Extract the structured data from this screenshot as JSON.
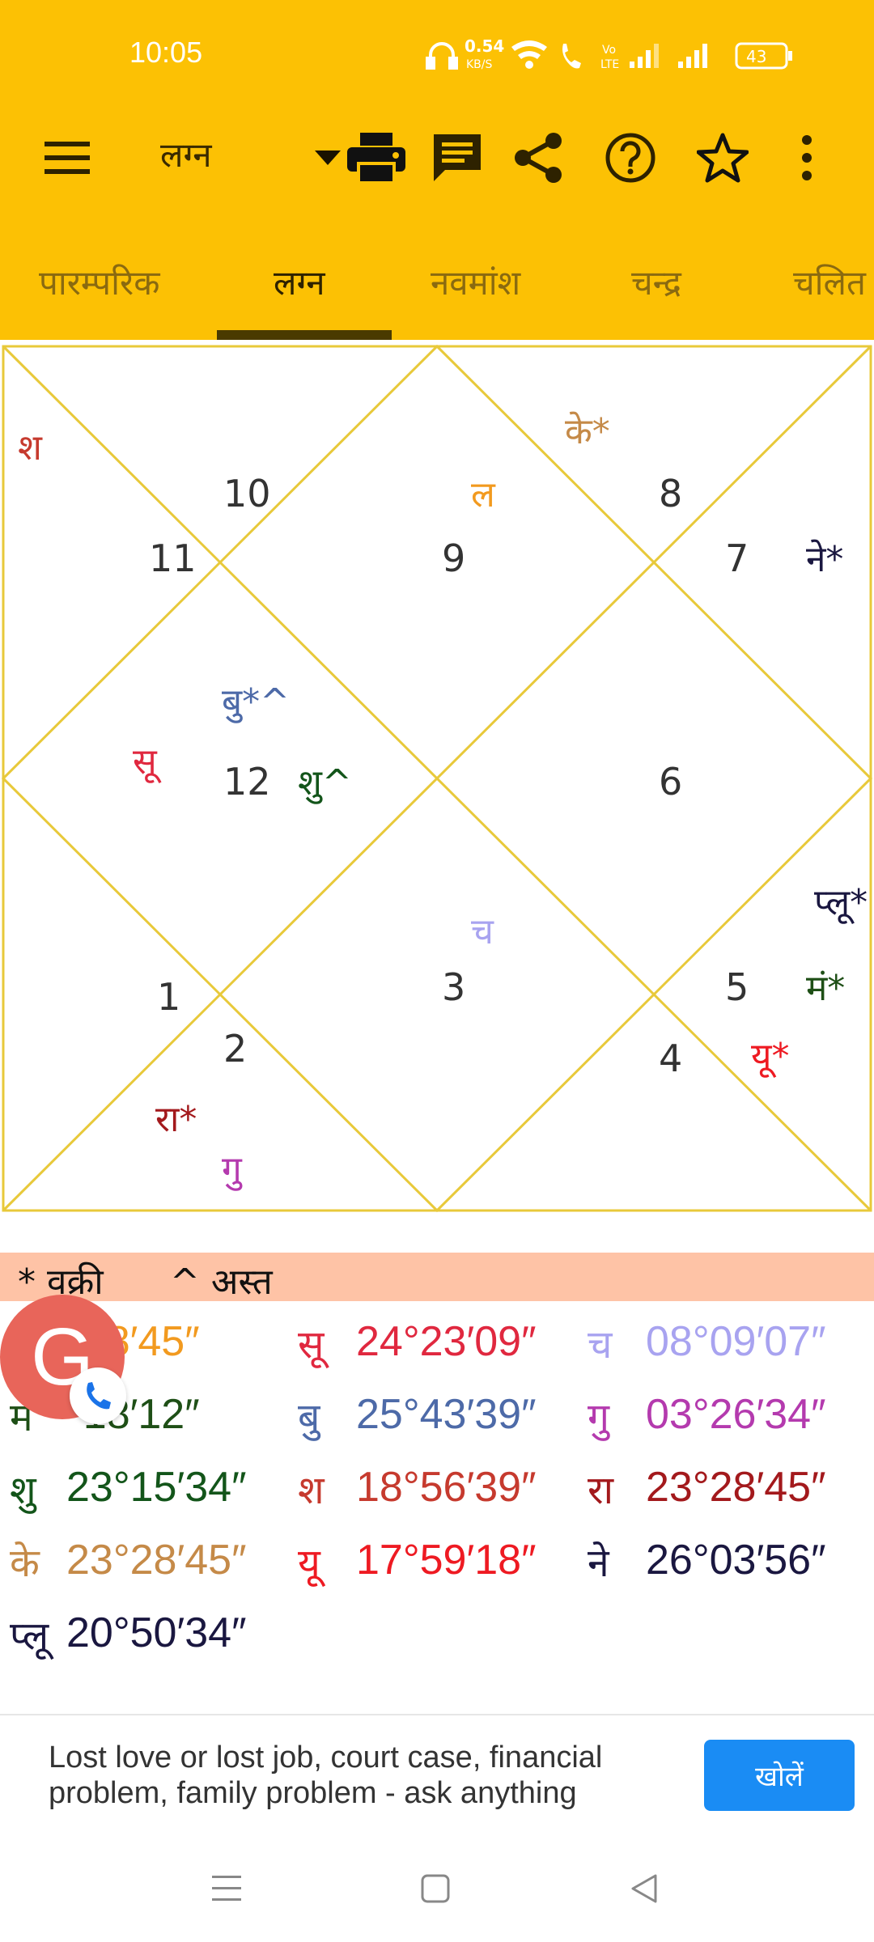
{
  "status": {
    "time": "10:05",
    "speed_value": "0.54",
    "speed_unit": "KB/S",
    "battery": "43"
  },
  "toolbar": {
    "title": "लग्न"
  },
  "tabs": [
    "पारम्परिक",
    "लग्न",
    "नवमांश",
    "चन्द्र",
    "चलित"
  ],
  "chart": {
    "houses": [
      "10",
      "11",
      "9",
      "8",
      "7",
      "12",
      "6",
      "3",
      "1",
      "2",
      "5",
      "4"
    ],
    "planets": {
      "sha": "श",
      "la": "ल",
      "ke": "के*",
      "ne": "ने*",
      "bu": "बु*^",
      "su": "सू",
      "shu": "शु^",
      "ch": "च",
      "plu": "प्लू*",
      "man": "मं*",
      "ra": "रा*",
      "gu": "गु",
      "yu": "यू*"
    },
    "colors": {
      "line": "#E8C93A"
    }
  },
  "legend": {
    "retro": "* वक्री",
    "combust": "^ अस्त"
  },
  "positions": [
    [
      {
        "p": "",
        "d": "°48′45″",
        "c": "#F29A1F"
      },
      {
        "p": "सू",
        "d": "24°23′09″",
        "c": "#E0283F"
      },
      {
        "p": "च",
        "d": "08°09′07″",
        "c": "#A8A3F0"
      }
    ],
    [
      {
        "p": "म",
        "d": "°18′12″",
        "c": "#1E4F16"
      },
      {
        "p": "बु",
        "d": "25°43′39″",
        "c": "#4D6AA8"
      },
      {
        "p": "गु",
        "d": "03°26′34″",
        "c": "#B43AAE"
      }
    ],
    [
      {
        "p": "शु",
        "d": "23°15′34″",
        "c": "#13551A"
      },
      {
        "p": "श",
        "d": "18°56′39″",
        "c": "#C63A2E"
      },
      {
        "p": "रा",
        "d": "23°28′45″",
        "c": "#A3191C"
      }
    ],
    [
      {
        "p": "के",
        "d": "23°28′45″",
        "c": "#C58A48"
      },
      {
        "p": "यू",
        "d": "17°59′18″",
        "c": "#EE1A22"
      },
      {
        "p": "ने",
        "d": "26°03′56″",
        "c": "#1A1740"
      }
    ],
    [
      {
        "p": "प्लू",
        "d": "20°50′34″",
        "c": "#1A1740"
      }
    ]
  ],
  "avatar": {
    "letter": "G"
  },
  "ad": {
    "text": "Lost love or lost job, court case, financial problem, family problem - ask anything",
    "button": "खोलें"
  }
}
